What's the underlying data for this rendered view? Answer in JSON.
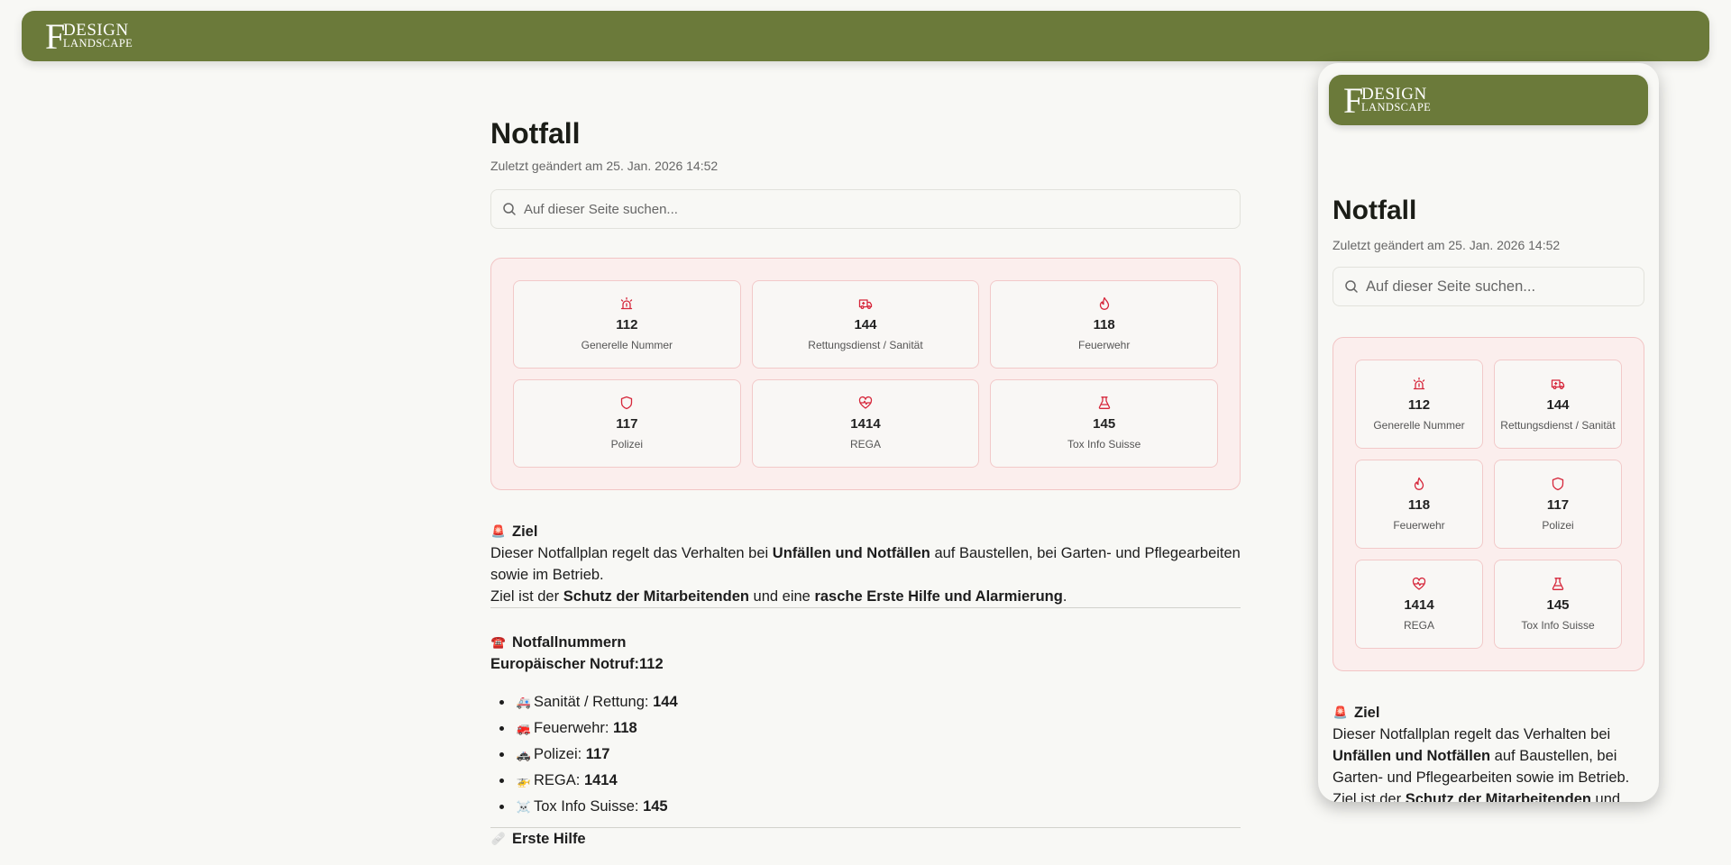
{
  "brand": {
    "mark": "F",
    "line1": "DESIGN",
    "line2": "LANDSCAPE"
  },
  "page": {
    "title": "Notfall",
    "meta": "Zuletzt geändert am 25. Jan. 2026 14:52",
    "search_placeholder": "Auf dieser Seite suchen..."
  },
  "emergency_cards": [
    {
      "icon": "siren-icon",
      "number": "112",
      "label": "Generelle Nummer"
    },
    {
      "icon": "ambulance-icon",
      "number": "144",
      "label": "Rettungsdienst / Sanität"
    },
    {
      "icon": "flame-icon",
      "number": "118",
      "label": "Feuerwehr"
    },
    {
      "icon": "shield-icon",
      "number": "117",
      "label": "Polizei"
    },
    {
      "icon": "heart-pulse-icon",
      "number": "1414",
      "label": "REGA"
    },
    {
      "icon": "flask-icon",
      "number": "145",
      "label": "Tox Info Suisse"
    }
  ],
  "ziel": {
    "emoji": "🚨",
    "heading": "Ziel",
    "p1_a": "Dieser Notfallplan regelt das Verhalten bei ",
    "p1_b": "Unfällen und Notfällen",
    "p1_c": " auf Baustellen, bei Garten- und Pflegearbeiten sowie im Betrieb.",
    "p2_a": "Ziel ist der ",
    "p2_b": "Schutz der Mitarbeitenden",
    "p2_c": " und eine ",
    "p2_d": "rasche Erste Hilfe und Alarmierung",
    "p2_e": "."
  },
  "numbers": {
    "emoji": "☎️",
    "heading": "Notfallnummern",
    "euro_label": "Europäischer Notruf:",
    "euro_value": "112",
    "items": [
      {
        "emoji": "🚑",
        "label": "Sanität / Rettung: ",
        "value": "144"
      },
      {
        "emoji": "🚒",
        "label": "Feuerwehr: ",
        "value": "118"
      },
      {
        "emoji": "🚓",
        "label": "Polizei: ",
        "value": "117"
      },
      {
        "emoji": "🚁",
        "label": "REGA: ",
        "value": "1414"
      },
      {
        "emoji": "☠️",
        "label": "Tox Info Suisse: ",
        "value": "145"
      }
    ]
  },
  "first_aid": {
    "emoji": "🩹",
    "heading": "Erste Hilfe"
  },
  "colors": {
    "brand_green": "#6b7a3a",
    "emergency_red": "#d6263a",
    "emergency_bg": "#fbeeed"
  }
}
